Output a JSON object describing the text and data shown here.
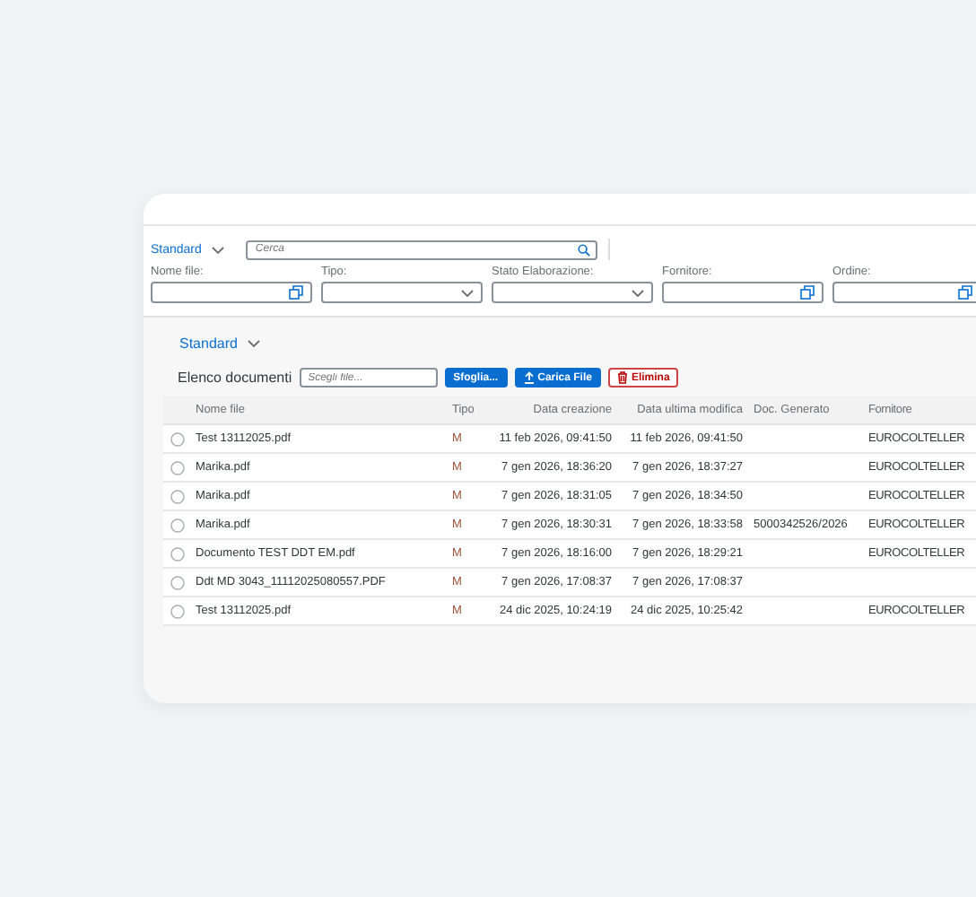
{
  "variant": {
    "label": "Standard"
  },
  "search": {
    "placeholder": "Cerca"
  },
  "filters": [
    {
      "label": "Nome file:",
      "kind": "valuehelp"
    },
    {
      "label": "Tipo:",
      "kind": "dropdown"
    },
    {
      "label": "Stato Elaborazione:",
      "kind": "dropdown"
    },
    {
      "label": "Fornitore:",
      "kind": "valuehelp"
    },
    {
      "label": "Ordine:",
      "kind": "valuehelp"
    }
  ],
  "table_variant": {
    "label": "Standard"
  },
  "toolbar": {
    "title": "Elenco documenti",
    "file_field": {
      "placeholder": "Scegli file..."
    },
    "buttons": [
      {
        "label": "Sfoglia...",
        "kind": "browse"
      },
      {
        "label": "Carica File",
        "kind": "upload"
      },
      {
        "label": "Elimina",
        "kind": "delete"
      }
    ]
  },
  "table": {
    "columns": [
      "Nome file",
      "Tipo",
      "Data creazione",
      "Data ultima modifica",
      "Doc. Generato",
      "Fornitore"
    ],
    "rows": [
      {
        "selected": false,
        "name": "Test 13112025.pdf",
        "type": "M",
        "created": "11 feb 2026, 09:41:50",
        "modified": "11 feb 2026, 09:41:50",
        "supplier": "EUROCOLTELLER"
      },
      {
        "selected": false,
        "name": "Marika.pdf",
        "type": "M",
        "created": "7 gen 2026, 18:36:20",
        "modified": "7 gen 2026, 18:37:27",
        "supplier": "EUROCOLTELLER"
      },
      {
        "selected": false,
        "name": "Marika.pdf",
        "type": "M",
        "created": "7 gen 2026, 18:31:05",
        "modified": "7 gen 2026, 18:34:50",
        "supplier": "EUROCOLTELLER"
      },
      {
        "selected": false,
        "name": "Marika.pdf",
        "type": "M",
        "created": "7 gen 2026, 18:30:31",
        "modified": "7 gen 2026, 18:33:58",
        "doc": "5000342526/2026",
        "supplier": "EUROCOLTELLER"
      },
      {
        "selected": false,
        "name": "Documento TEST DDT EM.pdf",
        "type": "M",
        "created": "7 gen 2026, 18:16:00",
        "modified": "7 gen 2026, 18:29:21",
        "supplier": "EUROCOLTELLER"
      },
      {
        "selected": false,
        "name": "Ddt MD 3043_11112025080557.PDF",
        "type": "M",
        "created": "7 gen 2026, 17:08:37",
        "modified": "7 gen 2026, 17:08:37"
      },
      {
        "selected": false,
        "name": "Test 13112025.pdf",
        "type": "M",
        "created": "24 dic 2025, 10:24:19",
        "modified": "24 dic 2025, 10:25:42",
        "supplier": "EUROCOLTELLER"
      }
    ]
  }
}
